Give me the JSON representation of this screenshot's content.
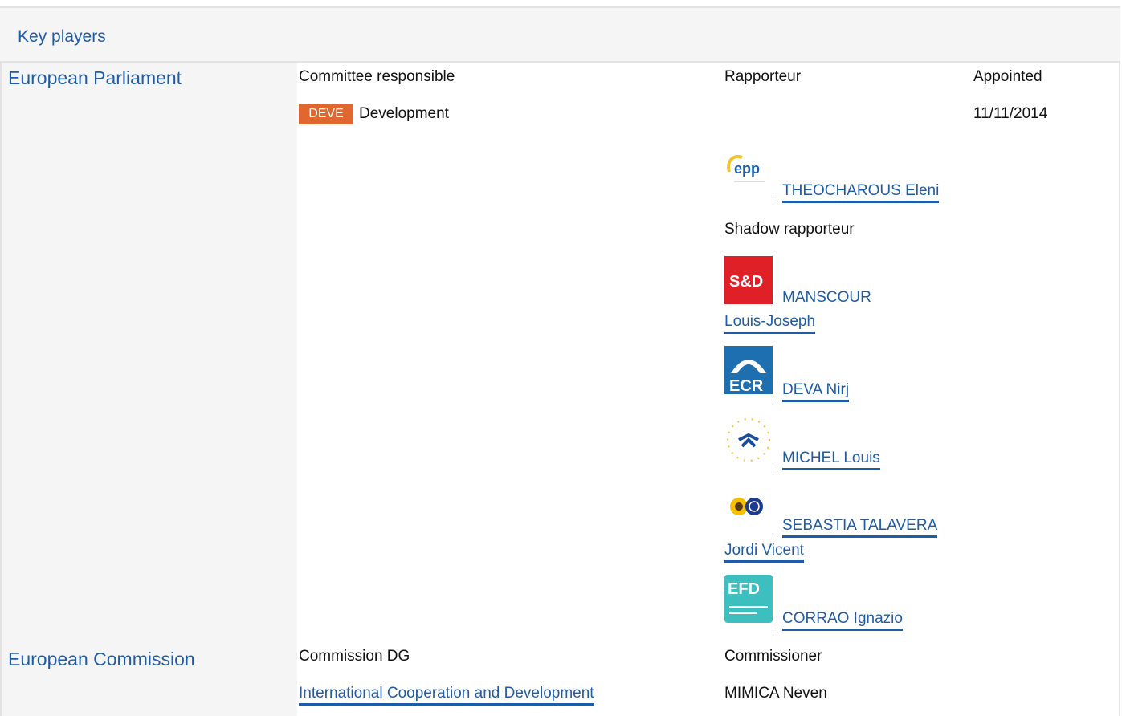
{
  "header": {
    "title": "Key players"
  },
  "parliament": {
    "label": "European Parliament",
    "col_committee": "Committee responsible",
    "col_rapporteur": "Rapporteur",
    "col_appointed": "Appointed",
    "committee_badge": "DEVE",
    "committee_name": "Development",
    "appointed_date": "11/11/2014",
    "rapporteur": {
      "group_logo": "epp-logo",
      "name": "THEOCHAROUS Eleni"
    },
    "shadow_label": "Shadow rapporteur",
    "shadows": [
      {
        "group_logo": "sd-logo",
        "logo_text": "S&D",
        "name_line1": "MANSCOUR",
        "name_line2": "Louis-Joseph"
      },
      {
        "group_logo": "ecr-logo",
        "logo_text": "ECR",
        "name_line1": "DEVA Nirj"
      },
      {
        "group_logo": "alde-logo",
        "name_line1": "MICHEL Louis"
      },
      {
        "group_logo": "greens-efa-logo",
        "name_line1": "SEBASTIA TALAVERA",
        "name_line2": "Jordi Vicent"
      },
      {
        "group_logo": "efdd-logo",
        "logo_text": "EFD",
        "name_line1": "CORRAO Ignazio"
      }
    ]
  },
  "commission": {
    "label": "European Commission",
    "col_dg": "Commission DG",
    "col_commissioner": "Commissioner",
    "dg_name": "International Cooperation and Development",
    "commissioner": "MIMICA Neven"
  }
}
